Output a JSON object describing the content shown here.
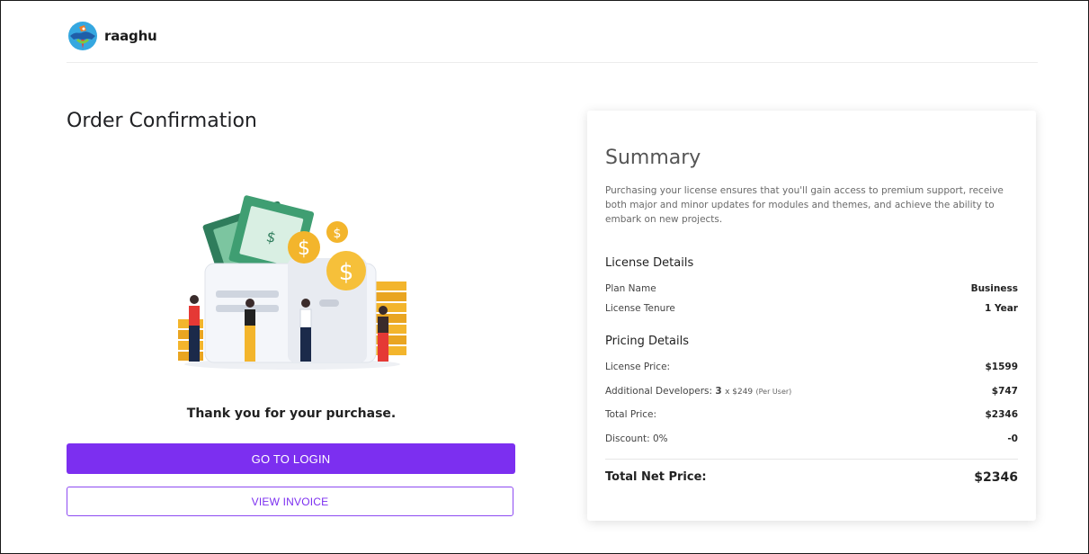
{
  "brand": {
    "name": "raaghu"
  },
  "page": {
    "title": "Order Confirmation",
    "thank_you": "Thank you for your purchase."
  },
  "actions": {
    "login_label": "GO TO LOGIN",
    "invoice_label": "VIEW INVOICE"
  },
  "summary": {
    "title": "Summary",
    "description": "Purchasing your license ensures that you'll gain access to premium support, receive both major and minor updates for modules and themes, and achieve the ability to embark on new projects.",
    "license_details": {
      "heading": "License Details",
      "plan_label": "Plan Name",
      "plan_value": "Business",
      "tenure_label": "License Tenure",
      "tenure_value": "1 Year"
    },
    "pricing_details": {
      "heading": "Pricing Details",
      "license_price_label": "License Price:",
      "license_price_value": "$1599",
      "dev_label": "Additional Developers:",
      "dev_count": "3",
      "dev_multiplier": "x $249",
      "dev_per_user": "(Per User)",
      "dev_value": "$747",
      "total_price_label": "Total Price:",
      "total_price_value": "$2346",
      "discount_label": "Discount: 0%",
      "discount_value": "-0"
    },
    "total_net_label": "Total Net Price:",
    "total_net_value": "$2346"
  },
  "colors": {
    "accent": "#7c2ff0",
    "money_green": "#3f8e6d",
    "coin_gold": "#f3b52c"
  },
  "icons": {
    "logo": "parrot-logo",
    "illustration": "wallet-money-illustration"
  }
}
